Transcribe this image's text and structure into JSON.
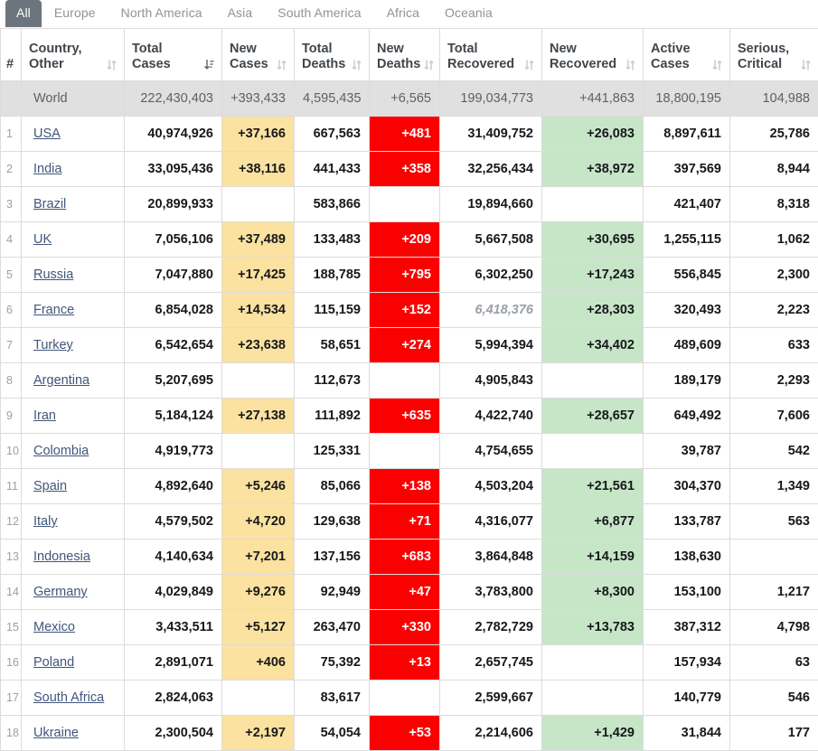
{
  "tabs": [
    {
      "label": "All",
      "active": true
    },
    {
      "label": "Europe",
      "active": false
    },
    {
      "label": "North America",
      "active": false
    },
    {
      "label": "Asia",
      "active": false
    },
    {
      "label": "South America",
      "active": false
    },
    {
      "label": "Africa",
      "active": false
    },
    {
      "label": "Oceania",
      "active": false
    }
  ],
  "columns": [
    {
      "key": "index",
      "label": "#",
      "sortable": false,
      "sort": "none"
    },
    {
      "key": "country",
      "label": "Country, Other",
      "sortable": true,
      "sort": "none"
    },
    {
      "key": "total_cases",
      "label": "Total Cases",
      "sortable": true,
      "sort": "desc"
    },
    {
      "key": "new_cases",
      "label": "New Cases",
      "sortable": true,
      "sort": "none"
    },
    {
      "key": "total_deaths",
      "label": "Total Deaths",
      "sortable": true,
      "sort": "none"
    },
    {
      "key": "new_deaths",
      "label": "New Deaths",
      "sortable": true,
      "sort": "none"
    },
    {
      "key": "total_recovered",
      "label": "Total Recovered",
      "sortable": true,
      "sort": "none"
    },
    {
      "key": "new_recovered",
      "label": "New Recovered",
      "sortable": true,
      "sort": "none"
    },
    {
      "key": "active_cases",
      "label": "Active Cases",
      "sortable": true,
      "sort": "none"
    },
    {
      "key": "serious_critical",
      "label": "Serious, Critical",
      "sortable": true,
      "sort": "none"
    }
  ],
  "colors": {
    "active_tab_bg": "#6c757d",
    "tab_text": "#8d9499",
    "new_cases_bg": "#fbe2a0",
    "new_deaths_bg": "#fb0000",
    "new_recovered_bg": "#c7e6c8",
    "world_row_bg": "#e0e0e0",
    "link": "#41567a",
    "border": "#dcdcdc"
  },
  "world_row": {
    "index": "",
    "country": "World",
    "total_cases": "222,430,403",
    "new_cases": "+393,433",
    "total_deaths": "4,595,435",
    "new_deaths": "+6,565",
    "total_recovered": "199,034,773",
    "new_recovered": "+441,863",
    "active_cases": "18,800,195",
    "serious_critical": "104,988"
  },
  "rows": [
    {
      "index": "1",
      "country": "USA",
      "total_cases": "40,974,926",
      "new_cases": "+37,166",
      "total_deaths": "667,563",
      "new_deaths": "+481",
      "total_recovered": "31,409,752",
      "total_recovered_estimate": false,
      "new_recovered": "+26,083",
      "active_cases": "8,897,611",
      "serious_critical": "25,786"
    },
    {
      "index": "2",
      "country": "India",
      "total_cases": "33,095,436",
      "new_cases": "+38,116",
      "total_deaths": "441,433",
      "new_deaths": "+358",
      "total_recovered": "32,256,434",
      "total_recovered_estimate": false,
      "new_recovered": "+38,972",
      "active_cases": "397,569",
      "serious_critical": "8,944"
    },
    {
      "index": "3",
      "country": "Brazil",
      "total_cases": "20,899,933",
      "new_cases": "",
      "total_deaths": "583,866",
      "new_deaths": "",
      "total_recovered": "19,894,660",
      "total_recovered_estimate": false,
      "new_recovered": "",
      "active_cases": "421,407",
      "serious_critical": "8,318"
    },
    {
      "index": "4",
      "country": "UK",
      "total_cases": "7,056,106",
      "new_cases": "+37,489",
      "total_deaths": "133,483",
      "new_deaths": "+209",
      "total_recovered": "5,667,508",
      "total_recovered_estimate": false,
      "new_recovered": "+30,695",
      "active_cases": "1,255,115",
      "serious_critical": "1,062"
    },
    {
      "index": "5",
      "country": "Russia",
      "total_cases": "7,047,880",
      "new_cases": "+17,425",
      "total_deaths": "188,785",
      "new_deaths": "+795",
      "total_recovered": "6,302,250",
      "total_recovered_estimate": false,
      "new_recovered": "+17,243",
      "active_cases": "556,845",
      "serious_critical": "2,300"
    },
    {
      "index": "6",
      "country": "France",
      "total_cases": "6,854,028",
      "new_cases": "+14,534",
      "total_deaths": "115,159",
      "new_deaths": "+152",
      "total_recovered": "6,418,376",
      "total_recovered_estimate": true,
      "new_recovered": "+28,303",
      "active_cases": "320,493",
      "serious_critical": "2,223"
    },
    {
      "index": "7",
      "country": "Turkey",
      "total_cases": "6,542,654",
      "new_cases": "+23,638",
      "total_deaths": "58,651",
      "new_deaths": "+274",
      "total_recovered": "5,994,394",
      "total_recovered_estimate": false,
      "new_recovered": "+34,402",
      "active_cases": "489,609",
      "serious_critical": "633"
    },
    {
      "index": "8",
      "country": "Argentina",
      "total_cases": "5,207,695",
      "new_cases": "",
      "total_deaths": "112,673",
      "new_deaths": "",
      "total_recovered": "4,905,843",
      "total_recovered_estimate": false,
      "new_recovered": "",
      "active_cases": "189,179",
      "serious_critical": "2,293"
    },
    {
      "index": "9",
      "country": "Iran",
      "total_cases": "5,184,124",
      "new_cases": "+27,138",
      "total_deaths": "111,892",
      "new_deaths": "+635",
      "total_recovered": "4,422,740",
      "total_recovered_estimate": false,
      "new_recovered": "+28,657",
      "active_cases": "649,492",
      "serious_critical": "7,606"
    },
    {
      "index": "10",
      "country": "Colombia",
      "total_cases": "4,919,773",
      "new_cases": "",
      "total_deaths": "125,331",
      "new_deaths": "",
      "total_recovered": "4,754,655",
      "total_recovered_estimate": false,
      "new_recovered": "",
      "active_cases": "39,787",
      "serious_critical": "542"
    },
    {
      "index": "11",
      "country": "Spain",
      "total_cases": "4,892,640",
      "new_cases": "+5,246",
      "total_deaths": "85,066",
      "new_deaths": "+138",
      "total_recovered": "4,503,204",
      "total_recovered_estimate": false,
      "new_recovered": "+21,561",
      "active_cases": "304,370",
      "serious_critical": "1,349"
    },
    {
      "index": "12",
      "country": "Italy",
      "total_cases": "4,579,502",
      "new_cases": "+4,720",
      "total_deaths": "129,638",
      "new_deaths": "+71",
      "total_recovered": "4,316,077",
      "total_recovered_estimate": false,
      "new_recovered": "+6,877",
      "active_cases": "133,787",
      "serious_critical": "563"
    },
    {
      "index": "13",
      "country": "Indonesia",
      "total_cases": "4,140,634",
      "new_cases": "+7,201",
      "total_deaths": "137,156",
      "new_deaths": "+683",
      "total_recovered": "3,864,848",
      "total_recovered_estimate": false,
      "new_recovered": "+14,159",
      "active_cases": "138,630",
      "serious_critical": ""
    },
    {
      "index": "14",
      "country": "Germany",
      "total_cases": "4,029,849",
      "new_cases": "+9,276",
      "total_deaths": "92,949",
      "new_deaths": "+47",
      "total_recovered": "3,783,800",
      "total_recovered_estimate": false,
      "new_recovered": "+8,300",
      "active_cases": "153,100",
      "serious_critical": "1,217"
    },
    {
      "index": "15",
      "country": "Mexico",
      "total_cases": "3,433,511",
      "new_cases": "+5,127",
      "total_deaths": "263,470",
      "new_deaths": "+330",
      "total_recovered": "2,782,729",
      "total_recovered_estimate": false,
      "new_recovered": "+13,783",
      "active_cases": "387,312",
      "serious_critical": "4,798"
    },
    {
      "index": "16",
      "country": "Poland",
      "total_cases": "2,891,071",
      "new_cases": "+406",
      "total_deaths": "75,392",
      "new_deaths": "+13",
      "total_recovered": "2,657,745",
      "total_recovered_estimate": false,
      "new_recovered": "",
      "active_cases": "157,934",
      "serious_critical": "63"
    },
    {
      "index": "17",
      "country": "South Africa",
      "total_cases": "2,824,063",
      "new_cases": "",
      "total_deaths": "83,617",
      "new_deaths": "",
      "total_recovered": "2,599,667",
      "total_recovered_estimate": false,
      "new_recovered": "",
      "active_cases": "140,779",
      "serious_critical": "546"
    },
    {
      "index": "18",
      "country": "Ukraine",
      "total_cases": "2,300,504",
      "new_cases": "+2,197",
      "total_deaths": "54,054",
      "new_deaths": "+53",
      "total_recovered": "2,214,606",
      "total_recovered_estimate": false,
      "new_recovered": "+1,429",
      "active_cases": "31,844",
      "serious_critical": "177"
    }
  ]
}
